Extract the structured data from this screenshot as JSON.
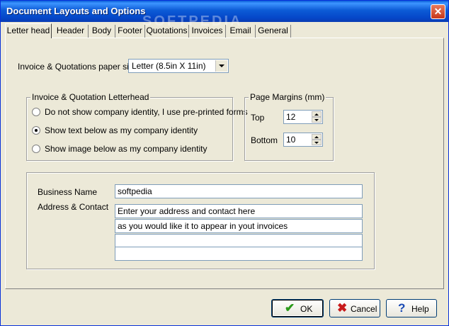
{
  "window": {
    "title": "Document Layouts and Options",
    "close_glyph": "✕"
  },
  "tabs": [
    {
      "label": "Letter head"
    },
    {
      "label": "Header"
    },
    {
      "label": "Body"
    },
    {
      "label": "Footer"
    },
    {
      "label": "Quotations"
    },
    {
      "label": "Invoices"
    },
    {
      "label": "Email"
    },
    {
      "label": "General"
    }
  ],
  "paper": {
    "label": "Invoice & Quotations paper size",
    "value": "Letter (8.5in X 11in)"
  },
  "letterhead": {
    "legend": "Invoice & Quotation Letterhead",
    "options": [
      {
        "label": "Do not show company identity, I use pre-printed forms",
        "checked": false
      },
      {
        "label": "Show text below as my company identity",
        "checked": true
      },
      {
        "label": "Show image below as my company identity",
        "checked": false
      }
    ]
  },
  "margins": {
    "legend": "Page Margins (mm)",
    "top_label": "Top",
    "top_value": "12",
    "bottom_label": "Bottom",
    "bottom_value": "10"
  },
  "business": {
    "name_label": "Business Name",
    "name_value": "softpedia",
    "address_label": "Address & Contact",
    "address_lines": [
      "Enter your address and contact here",
      "as you would like it to appear in yout invoices",
      "",
      ""
    ]
  },
  "buttons": {
    "ok": "OK",
    "cancel": "Cancel",
    "help": "Help"
  },
  "watermark": "SOFTPEDIA",
  "colors": {
    "titlebar": "#0547c9",
    "dialog_bg": "#ece9d8",
    "ok_icon": "#2a9a1a",
    "cancel_icon": "#c81a1a",
    "help_icon": "#1a4ab4"
  }
}
